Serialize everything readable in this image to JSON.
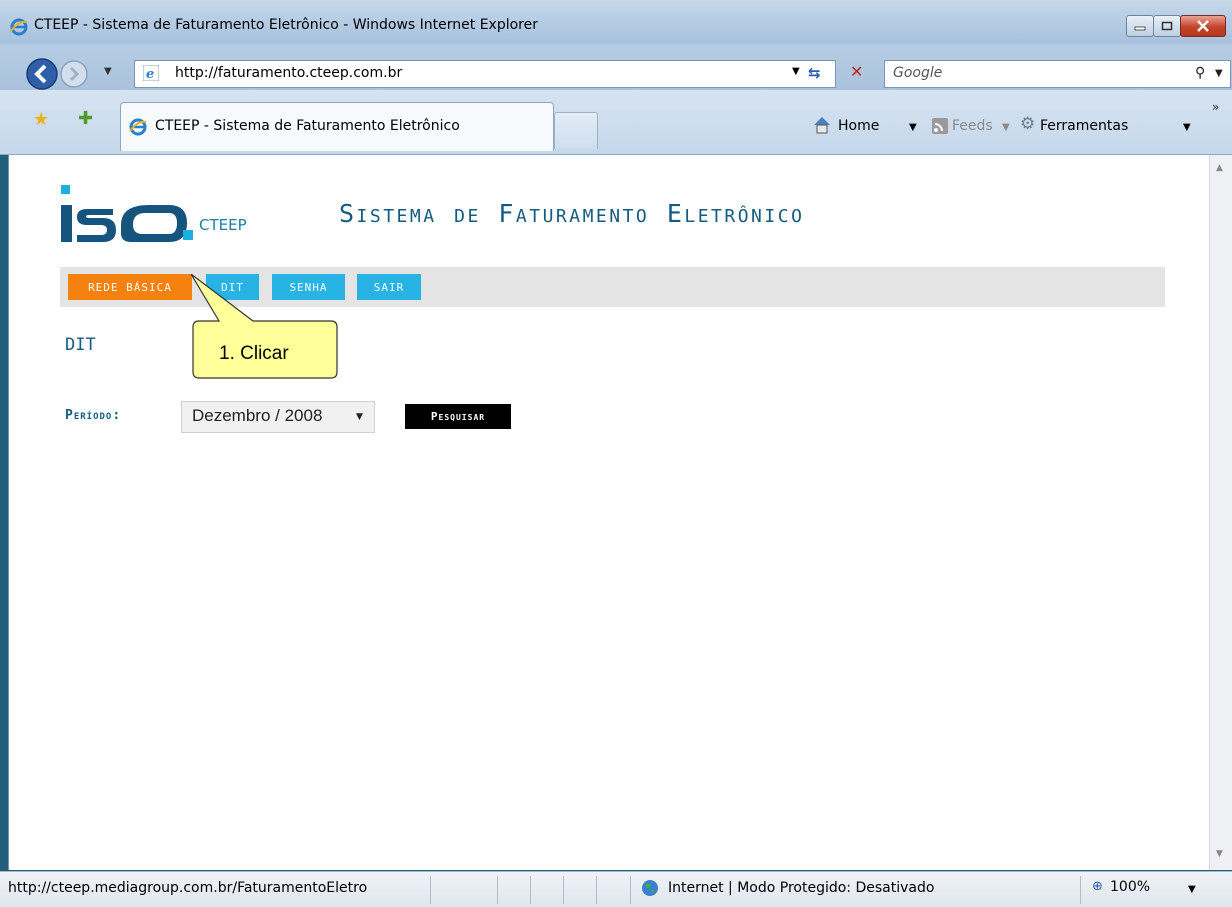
{
  "window": {
    "title": "CTEEP - Sistema de Faturamento Eletrônico - Windows Internet Explorer"
  },
  "addressbar": {
    "url": "http://faturamento.cteep.com.br",
    "search_placeholder": "Google"
  },
  "tabs": [
    {
      "label": "CTEEP - Sistema de Faturamento Eletrônico"
    }
  ],
  "commandbar": {
    "home": "Home",
    "feeds": "Feeds",
    "tools": "Ferramentas"
  },
  "page": {
    "logo_subtext": "CTEEP",
    "title": "Sistema de Faturamento Eletrônico",
    "menu": [
      {
        "label": "REDE BÁSICA"
      },
      {
        "label": "DIT"
      },
      {
        "label": "SENHA"
      },
      {
        "label": "SAIR"
      }
    ],
    "callout": "1. Clicar",
    "section_title": "DIT",
    "periodo_label": "Período:",
    "periodo_value": "Dezembro / 2008",
    "search_button": "Pesquisar"
  },
  "statusbar": {
    "url": "http://cteep.mediagroup.com.br/FaturamentoEletro",
    "zone": "Internet | Modo Protegido: Desativado",
    "zoom": "100%"
  },
  "colors": {
    "menu_active": "#f5810f",
    "menu_inactive": "#27b3e4",
    "brand_text": "#155b80",
    "callout_fill": "#ffff99"
  }
}
